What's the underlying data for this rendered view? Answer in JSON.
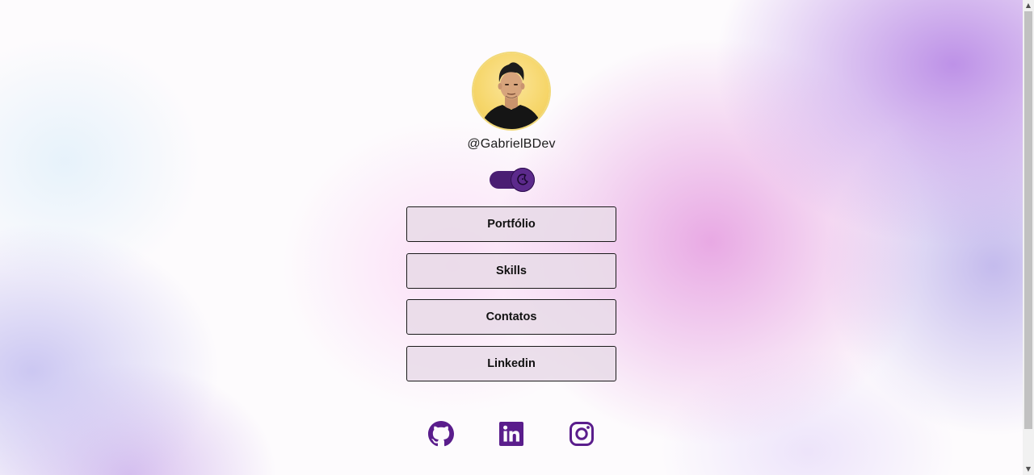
{
  "profile": {
    "username": "@GabrielBDev",
    "avatar_icon": "profile-photo"
  },
  "theme_toggle": {
    "state": "dark",
    "icon": "moon-icon",
    "track_color": "#4a1e73"
  },
  "links": [
    {
      "label": "Portfólio"
    },
    {
      "label": "Skills"
    },
    {
      "label": "Contatos"
    },
    {
      "label": "Linkedin"
    }
  ],
  "social": [
    {
      "name": "github-icon"
    },
    {
      "name": "linkedin-icon"
    },
    {
      "name": "instagram-icon"
    }
  ],
  "colors": {
    "accent": "#5a1d8c",
    "button_bg": "#e8dae8",
    "text": "#111111"
  },
  "scrollbar": {
    "up_arrow": "▲",
    "down_arrow": "▼"
  }
}
